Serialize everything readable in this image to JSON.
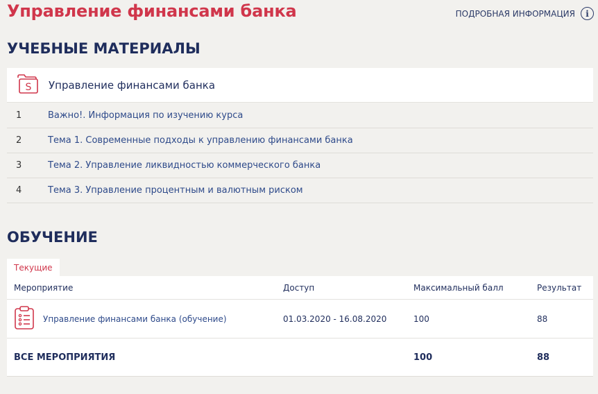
{
  "header": {
    "title": "Управление финансами банка",
    "info_label": "ПОДРОБНАЯ ИНФОРМАЦИЯ",
    "info_icon": "info-icon"
  },
  "materials": {
    "section_title": "УЧЕБНЫЕ МАТЕРИАЛЫ",
    "card_title": "Управление финансами банка",
    "card_icon": "folder-s-icon",
    "items": [
      {
        "num": "1",
        "label": "Важно!. Информация по изучению курса"
      },
      {
        "num": "2",
        "label": "Тема 1. Современные подходы к управлению финансами банка"
      },
      {
        "num": "3",
        "label": "Тема 2. Управление ликвидностью коммерческого банка"
      },
      {
        "num": "4",
        "label": "Тема 3. Управление процентным и валютным риском"
      }
    ]
  },
  "training": {
    "section_title": "ОБУЧЕНИЕ",
    "tab_label": "Текущие",
    "columns": [
      "Мероприятие",
      "Доступ",
      "Максимальный балл",
      "Результат"
    ],
    "rows": [
      {
        "event": "Управление финансами банка (обучение)",
        "access": "01.03.2020 - 16.08.2020",
        "max_score": "100",
        "result": "88",
        "icon": "clipboard-icon"
      }
    ],
    "totals": {
      "label": "ВСЕ МЕРОПРИЯТИЯ",
      "max_score": "100",
      "result": "88"
    }
  },
  "colors": {
    "accent_red": "#d0364b",
    "navy": "#1f2d5c",
    "link": "#2e4a8a",
    "background": "#f2f1ee"
  }
}
